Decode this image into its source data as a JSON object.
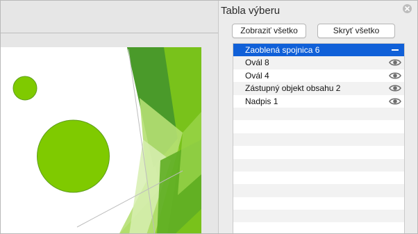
{
  "pane": {
    "title": "Tabla výberu",
    "show_all": "Zobraziť všetko",
    "hide_all": "Skryť všetko",
    "items": [
      {
        "label": "Zaoblená spojnica 6",
        "selected": true,
        "icon": "dash-icon"
      },
      {
        "label": "Ovál 8",
        "selected": false,
        "icon": "eye-icon"
      },
      {
        "label": "Ovál 4",
        "selected": false,
        "icon": "eye-icon"
      },
      {
        "label": "Zástupný objekt obsahu 2",
        "selected": false,
        "icon": "eye-icon"
      },
      {
        "label": "Nadpis 1",
        "selected": false,
        "icon": "eye-icon"
      }
    ],
    "empty_rows": 10
  },
  "colors": {
    "selection": "#1060d8",
    "shape_green": "#7fca00",
    "shape_green_border": "#5f9e1b"
  }
}
